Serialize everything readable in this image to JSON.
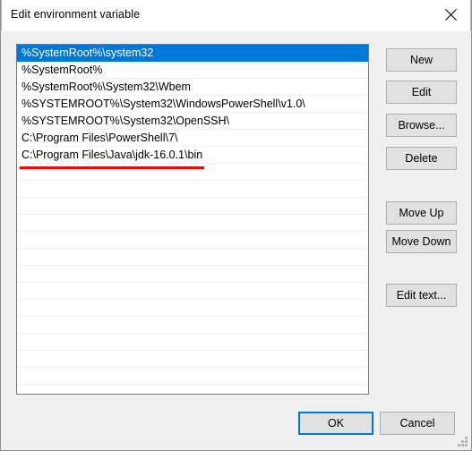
{
  "window": {
    "title": "Edit environment variable",
    "close_icon": "close-icon"
  },
  "list": {
    "selected_index": 0,
    "items": [
      "%SystemRoot%\\system32",
      "%SystemRoot%",
      "%SystemRoot%\\System32\\Wbem",
      "%SYSTEMROOT%\\System32\\WindowsPowerShell\\v1.0\\",
      "%SYSTEMROOT%\\System32\\OpenSSH\\",
      "C:\\Program Files\\PowerShell\\7\\",
      "C:\\Program Files\\Java\\jdk-16.0.1\\bin"
    ],
    "empty_row_count": 13
  },
  "annotation": {
    "type": "underline",
    "color": "#ff0000",
    "targets_item_index": 6
  },
  "side_buttons": [
    {
      "key": "new",
      "label": "New"
    },
    {
      "key": "edit",
      "label": "Edit"
    },
    {
      "key": "browse",
      "label": "Browse..."
    },
    {
      "key": "delete",
      "label": "Delete"
    },
    {
      "key": "move_up",
      "label": "Move Up"
    },
    {
      "key": "move_down",
      "label": "Move Down"
    },
    {
      "key": "edit_text",
      "label": "Edit text..."
    }
  ],
  "bottom_buttons": [
    {
      "key": "ok",
      "label": "OK",
      "default": true
    },
    {
      "key": "cancel",
      "label": "Cancel",
      "default": false
    }
  ],
  "colors": {
    "selection": "#0078d7",
    "dialog_background": "#f0f0f0",
    "button_face": "#e1e1e1",
    "button_border": "#adadad",
    "annotation": "#ff0000"
  }
}
